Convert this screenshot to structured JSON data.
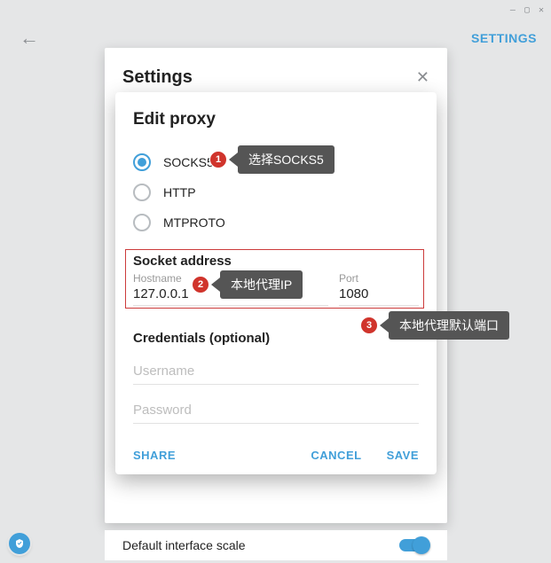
{
  "windowControls": {
    "minimize": "—",
    "maximize": "▢",
    "close": "✕"
  },
  "topnav": {
    "settings": "SETTINGS"
  },
  "settingsPanel": {
    "title": "Settings"
  },
  "bottomRow": {
    "label": "Default interface scale",
    "on": true
  },
  "proxy": {
    "title": "Edit proxy",
    "types": {
      "socks5": "SOCKS5",
      "http": "HTTP",
      "mtproto": "MTPROTO"
    },
    "socket_section": "Socket address",
    "hostname_label": "Hostname",
    "hostname_value": "127.0.0.1",
    "port_label": "Port",
    "port_value": "1080",
    "credentials_section": "Credentials (optional)",
    "username_placeholder": "Username",
    "password_placeholder": "Password",
    "share": "SHARE",
    "cancel": "CANCEL",
    "save": "SAVE"
  },
  "callouts": {
    "c1": {
      "n": "1",
      "text": "选择SOCKS5"
    },
    "c2": {
      "n": "2",
      "text": "本地代理IP"
    },
    "c3": {
      "n": "3",
      "text": "本地代理默认端口"
    }
  }
}
